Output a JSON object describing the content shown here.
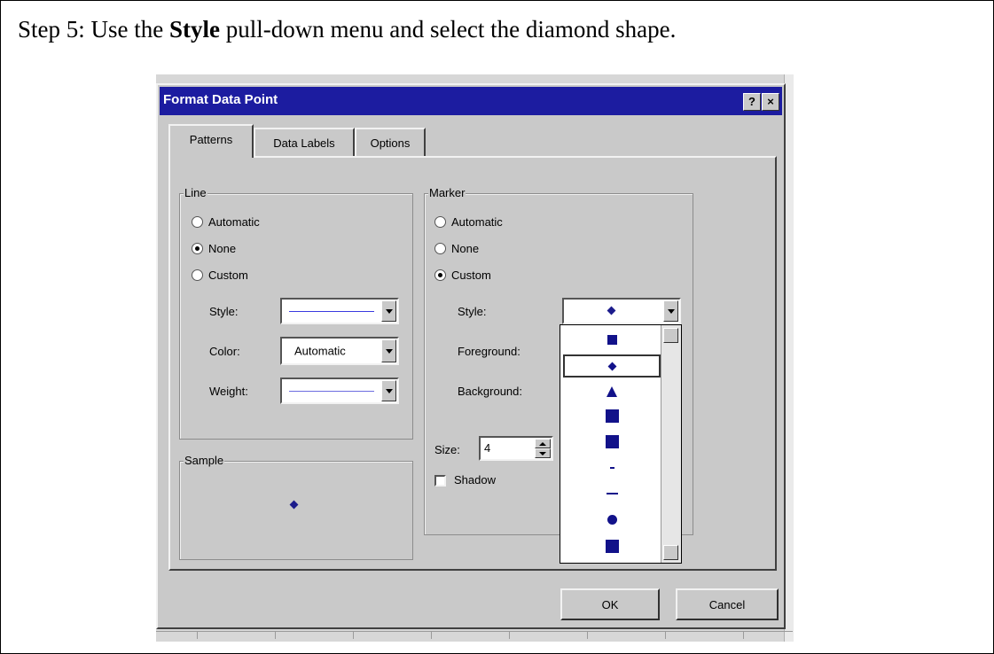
{
  "caption": {
    "prefix": "Step 5: Use the ",
    "bold": "Style",
    "suffix": " pull-down menu and select the diamond shape."
  },
  "dialog": {
    "title": "Format Data Point",
    "help_button": "?",
    "close_button": "×",
    "tabs": [
      {
        "label": "Patterns",
        "active": true
      },
      {
        "label": "Data Labels",
        "active": false
      },
      {
        "label": "Options",
        "active": false
      }
    ],
    "line_group": {
      "legend": "Line",
      "options": [
        "Automatic",
        "None",
        "Custom"
      ],
      "selected": "None",
      "style_label": "Style:",
      "color_label": "Color:",
      "color_value": "Automatic",
      "weight_label": "Weight:"
    },
    "marker_group": {
      "legend": "Marker",
      "options": [
        "Automatic",
        "None",
        "Custom"
      ],
      "selected": "Custom",
      "style_label": "Style:",
      "foreground_label": "Foreground:",
      "background_label": "Background:",
      "size_label": "Size:",
      "size_value": "4",
      "shadow_label": "Shadow",
      "shadow_checked": false
    },
    "sample_group": {
      "legend": "Sample"
    },
    "style_dropdown": {
      "current": "diamond",
      "options": [
        "square",
        "diamond",
        "triangle",
        "square",
        "square",
        "short-dash",
        "dash",
        "circle",
        "square"
      ],
      "highlighted": "diamond"
    },
    "ok_label": "OK",
    "cancel_label": "Cancel",
    "marker_color": "#1c1c8c",
    "title_bar_color": "#1c1ca0"
  }
}
